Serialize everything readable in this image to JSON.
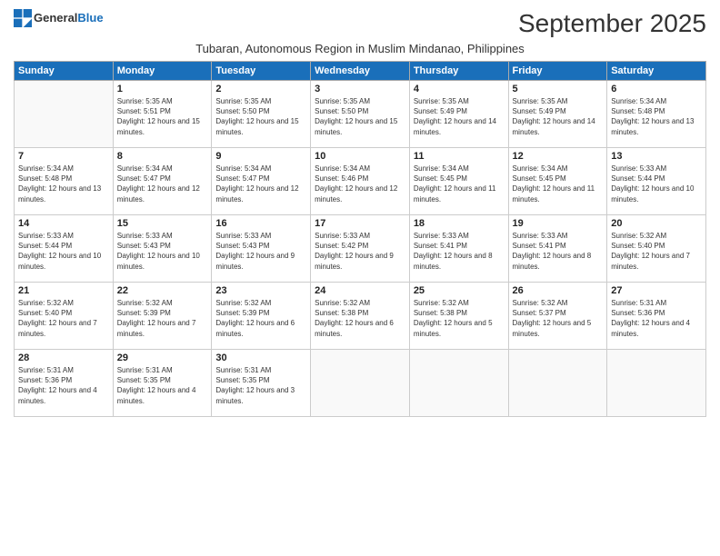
{
  "logo": {
    "general": "General",
    "blue": "Blue"
  },
  "title": "September 2025",
  "subtitle": "Tubaran, Autonomous Region in Muslim Mindanao, Philippines",
  "days_of_week": [
    "Sunday",
    "Monday",
    "Tuesday",
    "Wednesday",
    "Thursday",
    "Friday",
    "Saturday"
  ],
  "weeks": [
    [
      {
        "date": "",
        "info": ""
      },
      {
        "date": "1",
        "sunrise": "Sunrise: 5:35 AM",
        "sunset": "Sunset: 5:51 PM",
        "daylight": "Daylight: 12 hours and 15 minutes."
      },
      {
        "date": "2",
        "sunrise": "Sunrise: 5:35 AM",
        "sunset": "Sunset: 5:50 PM",
        "daylight": "Daylight: 12 hours and 15 minutes."
      },
      {
        "date": "3",
        "sunrise": "Sunrise: 5:35 AM",
        "sunset": "Sunset: 5:50 PM",
        "daylight": "Daylight: 12 hours and 15 minutes."
      },
      {
        "date": "4",
        "sunrise": "Sunrise: 5:35 AM",
        "sunset": "Sunset: 5:49 PM",
        "daylight": "Daylight: 12 hours and 14 minutes."
      },
      {
        "date": "5",
        "sunrise": "Sunrise: 5:35 AM",
        "sunset": "Sunset: 5:49 PM",
        "daylight": "Daylight: 12 hours and 14 minutes."
      },
      {
        "date": "6",
        "sunrise": "Sunrise: 5:34 AM",
        "sunset": "Sunset: 5:48 PM",
        "daylight": "Daylight: 12 hours and 13 minutes."
      }
    ],
    [
      {
        "date": "7",
        "sunrise": "Sunrise: 5:34 AM",
        "sunset": "Sunset: 5:48 PM",
        "daylight": "Daylight: 12 hours and 13 minutes."
      },
      {
        "date": "8",
        "sunrise": "Sunrise: 5:34 AM",
        "sunset": "Sunset: 5:47 PM",
        "daylight": "Daylight: 12 hours and 12 minutes."
      },
      {
        "date": "9",
        "sunrise": "Sunrise: 5:34 AM",
        "sunset": "Sunset: 5:47 PM",
        "daylight": "Daylight: 12 hours and 12 minutes."
      },
      {
        "date": "10",
        "sunrise": "Sunrise: 5:34 AM",
        "sunset": "Sunset: 5:46 PM",
        "daylight": "Daylight: 12 hours and 12 minutes."
      },
      {
        "date": "11",
        "sunrise": "Sunrise: 5:34 AM",
        "sunset": "Sunset: 5:45 PM",
        "daylight": "Daylight: 12 hours and 11 minutes."
      },
      {
        "date": "12",
        "sunrise": "Sunrise: 5:34 AM",
        "sunset": "Sunset: 5:45 PM",
        "daylight": "Daylight: 12 hours and 11 minutes."
      },
      {
        "date": "13",
        "sunrise": "Sunrise: 5:33 AM",
        "sunset": "Sunset: 5:44 PM",
        "daylight": "Daylight: 12 hours and 10 minutes."
      }
    ],
    [
      {
        "date": "14",
        "sunrise": "Sunrise: 5:33 AM",
        "sunset": "Sunset: 5:44 PM",
        "daylight": "Daylight: 12 hours and 10 minutes."
      },
      {
        "date": "15",
        "sunrise": "Sunrise: 5:33 AM",
        "sunset": "Sunset: 5:43 PM",
        "daylight": "Daylight: 12 hours and 10 minutes."
      },
      {
        "date": "16",
        "sunrise": "Sunrise: 5:33 AM",
        "sunset": "Sunset: 5:43 PM",
        "daylight": "Daylight: 12 hours and 9 minutes."
      },
      {
        "date": "17",
        "sunrise": "Sunrise: 5:33 AM",
        "sunset": "Sunset: 5:42 PM",
        "daylight": "Daylight: 12 hours and 9 minutes."
      },
      {
        "date": "18",
        "sunrise": "Sunrise: 5:33 AM",
        "sunset": "Sunset: 5:41 PM",
        "daylight": "Daylight: 12 hours and 8 minutes."
      },
      {
        "date": "19",
        "sunrise": "Sunrise: 5:33 AM",
        "sunset": "Sunset: 5:41 PM",
        "daylight": "Daylight: 12 hours and 8 minutes."
      },
      {
        "date": "20",
        "sunrise": "Sunrise: 5:32 AM",
        "sunset": "Sunset: 5:40 PM",
        "daylight": "Daylight: 12 hours and 7 minutes."
      }
    ],
    [
      {
        "date": "21",
        "sunrise": "Sunrise: 5:32 AM",
        "sunset": "Sunset: 5:40 PM",
        "daylight": "Daylight: 12 hours and 7 minutes."
      },
      {
        "date": "22",
        "sunrise": "Sunrise: 5:32 AM",
        "sunset": "Sunset: 5:39 PM",
        "daylight": "Daylight: 12 hours and 7 minutes."
      },
      {
        "date": "23",
        "sunrise": "Sunrise: 5:32 AM",
        "sunset": "Sunset: 5:39 PM",
        "daylight": "Daylight: 12 hours and 6 minutes."
      },
      {
        "date": "24",
        "sunrise": "Sunrise: 5:32 AM",
        "sunset": "Sunset: 5:38 PM",
        "daylight": "Daylight: 12 hours and 6 minutes."
      },
      {
        "date": "25",
        "sunrise": "Sunrise: 5:32 AM",
        "sunset": "Sunset: 5:38 PM",
        "daylight": "Daylight: 12 hours and 5 minutes."
      },
      {
        "date": "26",
        "sunrise": "Sunrise: 5:32 AM",
        "sunset": "Sunset: 5:37 PM",
        "daylight": "Daylight: 12 hours and 5 minutes."
      },
      {
        "date": "27",
        "sunrise": "Sunrise: 5:31 AM",
        "sunset": "Sunset: 5:36 PM",
        "daylight": "Daylight: 12 hours and 4 minutes."
      }
    ],
    [
      {
        "date": "28",
        "sunrise": "Sunrise: 5:31 AM",
        "sunset": "Sunset: 5:36 PM",
        "daylight": "Daylight: 12 hours and 4 minutes."
      },
      {
        "date": "29",
        "sunrise": "Sunrise: 5:31 AM",
        "sunset": "Sunset: 5:35 PM",
        "daylight": "Daylight: 12 hours and 4 minutes."
      },
      {
        "date": "30",
        "sunrise": "Sunrise: 5:31 AM",
        "sunset": "Sunset: 5:35 PM",
        "daylight": "Daylight: 12 hours and 3 minutes."
      },
      {
        "date": "",
        "info": ""
      },
      {
        "date": "",
        "info": ""
      },
      {
        "date": "",
        "info": ""
      },
      {
        "date": "",
        "info": ""
      }
    ]
  ]
}
